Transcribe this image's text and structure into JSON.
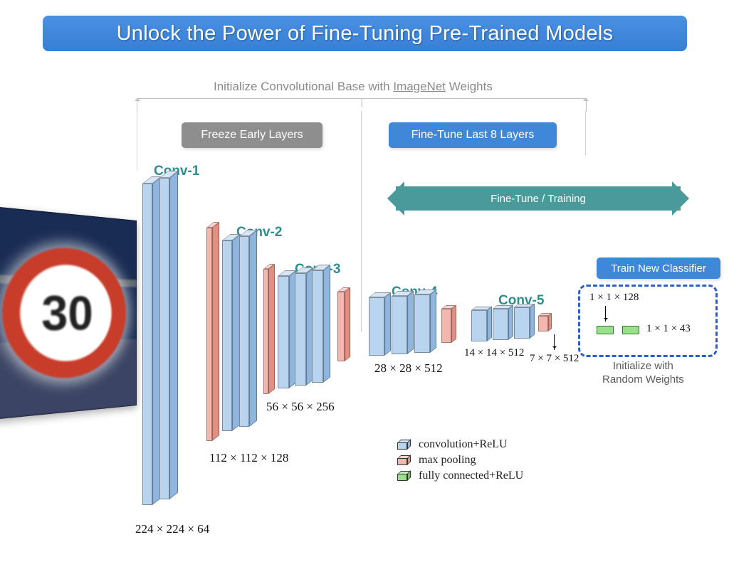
{
  "title": "Unlock the Power of Fine-Tuning Pre-Trained Models",
  "subtitle_prefix": "Initialize Convolutional Base with ",
  "subtitle_underlined": "ImageNet",
  "subtitle_suffix": " Weights",
  "tag_freeze": "Freeze Early Layers",
  "tag_finetune_last": "Fine-Tune Last 8 Layers",
  "arrow_label": "Fine-Tune / Training",
  "tag_classifier": "Train New Classifier",
  "init_random": "Initialize with\nRandom Weights",
  "input_sign_text": "30",
  "conv_blocks": [
    {
      "name": "Conv-1",
      "dim": "224 × 224 × 64"
    },
    {
      "name": "Conv-2",
      "dim": "112 × 112 × 128"
    },
    {
      "name": "Conv-3",
      "dim": "56 × 56 × 256"
    },
    {
      "name": "Conv-4",
      "dim": "28 × 28 × 512"
    },
    {
      "name": "Conv-5",
      "dim": "14 × 14 × 512"
    }
  ],
  "pool_out_dim": "7 × 7 × 512",
  "fc": [
    {
      "dim": "1 × 1 × 128"
    },
    {
      "dim": "1 × 1 × 43"
    }
  ],
  "legend": {
    "conv": "convolution+ReLU",
    "pool": "max pooling",
    "fc": "fully connected+ReLU"
  },
  "colors": {
    "conv_face": "#b9d4ef",
    "conv_shade": "#8fb6de",
    "conv_lite": "#d7e6f6",
    "pool_face": "#f2b7ae",
    "pool_shade": "#e48f82",
    "pool_lite": "#f8d6cf",
    "fc": "#9adf8c"
  }
}
